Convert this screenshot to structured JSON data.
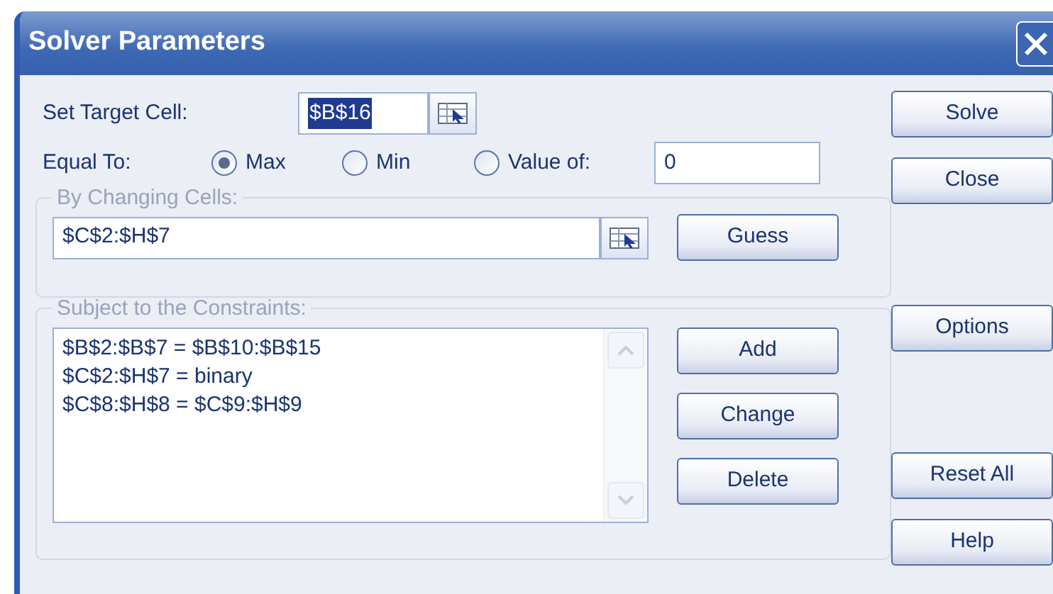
{
  "window": {
    "title": "Solver Parameters"
  },
  "target_cell": {
    "label": "Set Target Cell:",
    "value": "$B$16",
    "text_selected": true
  },
  "equal_to": {
    "label": "Equal To:",
    "value_field": "0",
    "options": [
      {
        "label": "Max",
        "selected": true
      },
      {
        "label": "Min",
        "selected": false
      },
      {
        "label": "Value of:",
        "selected": false
      }
    ]
  },
  "changing_cells": {
    "label": "By Changing Cells:",
    "value": "$C$2:$H$7",
    "button": {
      "label": "Guess"
    }
  },
  "constraints": {
    "label": "Subject to the Constraints:",
    "items": [
      "$B$2:$B$7 = $B$10:$B$15",
      "$C$2:$H$7 = binary",
      "$C$8:$H$8 = $C$9:$H$9"
    ],
    "buttons": [
      {
        "label": "Add"
      },
      {
        "label": "Change"
      },
      {
        "label": "Delete"
      }
    ]
  },
  "buttons": [
    {
      "label": "Solve"
    },
    {
      "label": "Close"
    },
    {
      "label": "Options"
    },
    {
      "label": "Reset All"
    },
    {
      "label": "Help"
    }
  ]
}
